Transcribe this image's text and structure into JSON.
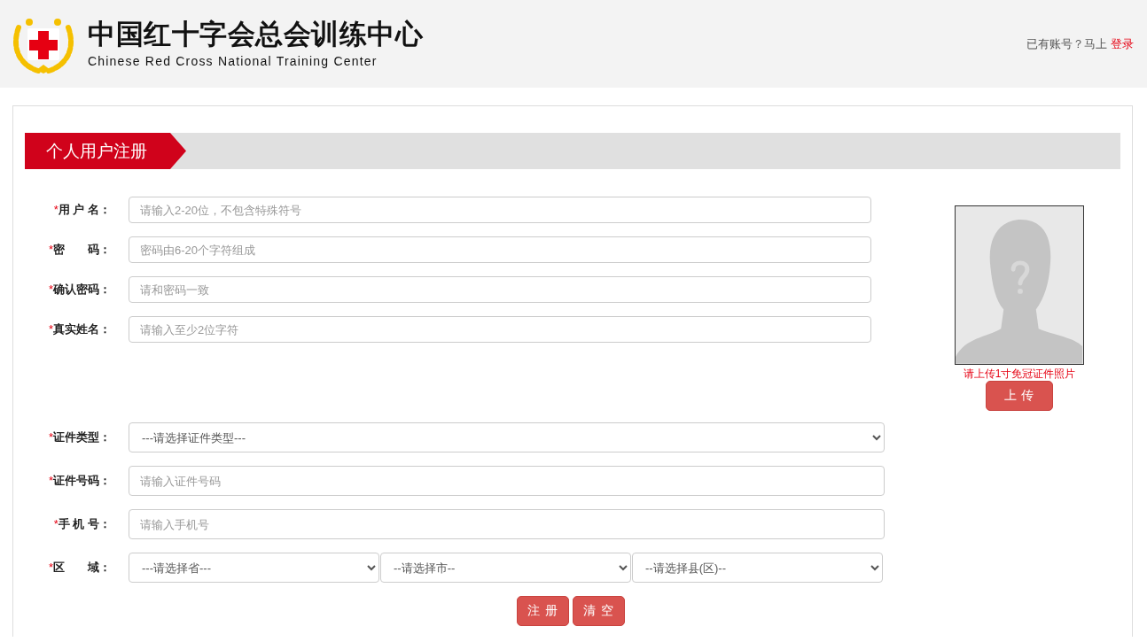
{
  "header": {
    "logo_title": "中国红十字会总会训练中心",
    "logo_subtitle": "Chinese Red Cross National Training Center",
    "login_prompt": "已有账号？马上",
    "login_link": "登录"
  },
  "section_title": "个人用户注册",
  "account_fields": [
    {
      "kind": "input",
      "mark": "*",
      "label": "用 户 名：",
      "placeholder": "请输入2-20位，不包含特殊符号"
    },
    {
      "kind": "input",
      "mark": "*",
      "label": "密　　码：",
      "placeholder": "密码由6-20个字符组成"
    },
    {
      "kind": "input",
      "mark": "*",
      "label": "确认密码：",
      "placeholder": "请和密码一致"
    },
    {
      "kind": "input",
      "mark": "*",
      "label": "真实姓名：",
      "placeholder": "请输入至少2位字符"
    }
  ],
  "photo": {
    "hint": "请上传1寸免冠证件照片",
    "upload_button": "上 传"
  },
  "identity_fields": [
    {
      "kind": "select",
      "mark": "*",
      "label": "证件类型：",
      "values": [
        "---请选择证件类型---"
      ]
    },
    {
      "kind": "input",
      "mark": "*",
      "label": "证件号码：",
      "placeholder": "请输入证件号码"
    },
    {
      "kind": "input",
      "mark": "*",
      "label": "手 机 号：",
      "placeholder": "请输入手机号"
    },
    {
      "kind": "select",
      "mark": "*",
      "label": "区　　域：",
      "values": [
        "---请选择省---",
        "--请选择市--",
        "--请选择县(区)--"
      ]
    }
  ],
  "buttons": [
    "注 册",
    "清 空"
  ]
}
